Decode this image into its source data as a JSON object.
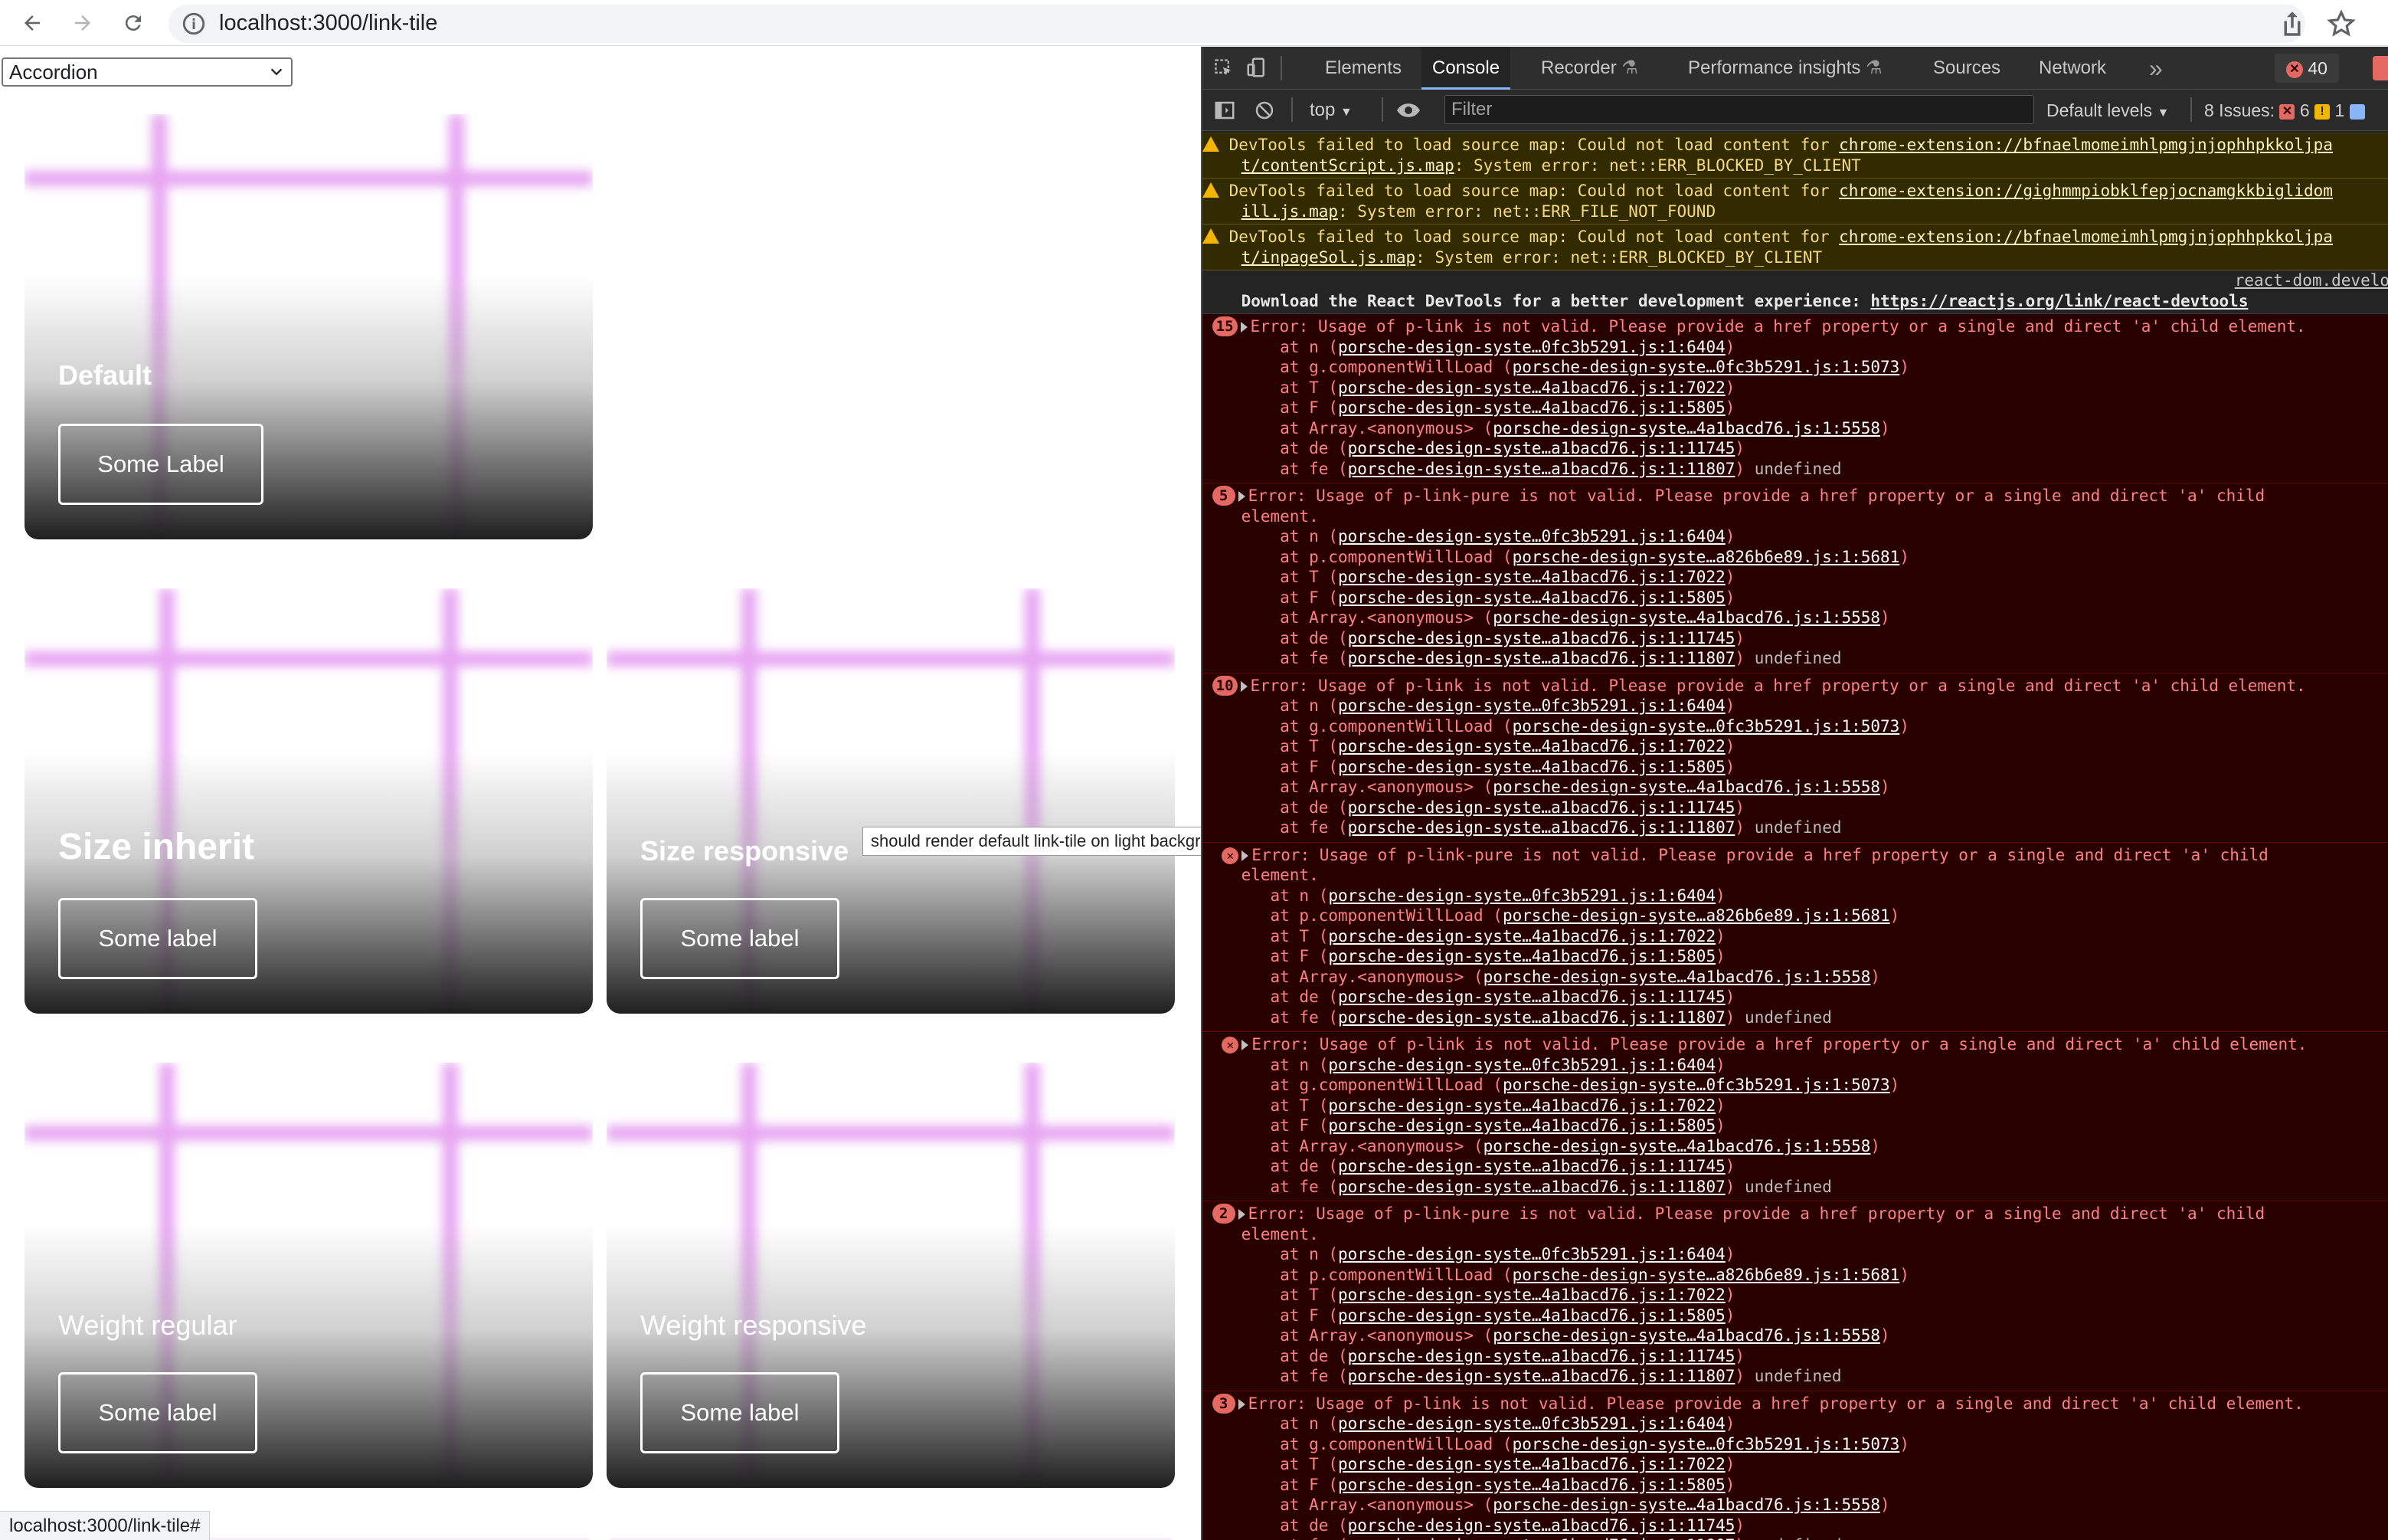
{
  "browser": {
    "url": "localhost:3000/link-tile"
  },
  "page": {
    "select_value": "Accordion",
    "tiles": [
      {
        "title": "Default",
        "button": "Some Label"
      },
      {
        "title": "Size inherit",
        "button": "Some label"
      },
      {
        "title": "Size responsive",
        "button": "Some label"
      },
      {
        "title": "Weight regular",
        "button": "Some label"
      },
      {
        "title": "Weight responsive",
        "button": "Some label"
      }
    ],
    "tooltip": "should render default link-tile on light background",
    "status_url": "localhost:3000/link-tile#"
  },
  "devtools": {
    "tabs": [
      "Elements",
      "Console",
      "Recorder",
      "Performance insights",
      "Sources",
      "Network"
    ],
    "more_tabs": "»",
    "error_count": "40",
    "context": "top",
    "filter_placeholder": "Filter",
    "levels": "Default levels",
    "issues_label": "8 Issues:",
    "issues_errors": "6",
    "issues_warnings": "1",
    "messages": [
      {
        "kind": "warn",
        "parts": [
          [
            "DevTools failed to load source map: Could not load content for ",
            ""
          ],
          [
            "chrome-extension://bfnaelmomeimhlpmgjnjophhpkkoljpa",
            "u"
          ]
        ],
        "cont": [
          [
            "t/contentScript.js.map",
            "u"
          ],
          [
            ": System error: net::ERR_BLOCKED_BY_CLIENT",
            ""
          ]
        ]
      },
      {
        "kind": "warn",
        "parts": [
          [
            "DevTools failed to load source map: Could not load content for ",
            ""
          ],
          [
            "chrome-extension://gighmmpiobklfepjocnamgkkbiglidom",
            "u"
          ]
        ],
        "cont": [
          [
            "ill.js.map",
            "u"
          ],
          [
            ": System error: net::ERR_FILE_NOT_FOUND",
            ""
          ]
        ]
      },
      {
        "kind": "warn",
        "parts": [
          [
            "DevTools failed to load source map: Could not load content for ",
            ""
          ],
          [
            "chrome-extension://bfnaelmomeimhlpmgjnjophhpkkoljpa",
            "u"
          ]
        ],
        "cont": [
          [
            "t/inpageSol.js.map",
            "u"
          ],
          [
            ": System error: net::ERR_BLOCKED_BY_CLIENT",
            ""
          ]
        ]
      }
    ],
    "react_source": "react-dom.develo",
    "react_text": "Download the React DevTools for a better development experience: ",
    "react_link": "https://reactjs.org/link/react-devtools",
    "errors": [
      {
        "badge": "15",
        "text": "Error: Usage of p-link is not valid. Please provide a href property or a single and direct 'a' child element.",
        "wrap": "",
        "cwl": "g.componentWillLoad",
        "cwl_src": "porsche-design-syste…0fc3b5291.js:1:5073"
      },
      {
        "badge": "5",
        "text": "Error: Usage of p-link-pure is not valid. Please provide a href property or a single and direct 'a' child",
        "wrap": "element.",
        "cwl": "p.componentWillLoad",
        "cwl_src": "porsche-design-syste…a826b6e89.js:1:5681"
      },
      {
        "badge": "10",
        "text": "Error: Usage of p-link is not valid. Please provide a href property or a single and direct 'a' child element.",
        "wrap": "",
        "cwl": "g.componentWillLoad",
        "cwl_src": "porsche-design-syste…0fc3b5291.js:1:5073"
      },
      {
        "badge": "",
        "text": "Error: Usage of p-link-pure is not valid. Please provide a href property or a single and direct 'a' child",
        "wrap": "element.",
        "cwl": "p.componentWillLoad",
        "cwl_src": "porsche-design-syste…a826b6e89.js:1:5681"
      },
      {
        "badge": "",
        "text": "Error: Usage of p-link is not valid. Please provide a href property or a single and direct 'a' child element.",
        "wrap": "",
        "cwl": "g.componentWillLoad",
        "cwl_src": "porsche-design-syste…0fc3b5291.js:1:5073"
      },
      {
        "badge": "2",
        "text": "Error: Usage of p-link-pure is not valid. Please provide a href property or a single and direct 'a' child",
        "wrap": "element.",
        "cwl": "p.componentWillLoad",
        "cwl_src": "porsche-design-syste…a826b6e89.js:1:5681"
      },
      {
        "badge": "3",
        "text": "Error: Usage of p-link is not valid. Please provide a href property or a single and direct 'a' child element.",
        "wrap": "",
        "cwl": "g.componentWillLoad",
        "cwl_src": "porsche-design-syste…0fc3b5291.js:1:5073"
      }
    ],
    "stack": {
      "n": "porsche-design-syste…0fc3b5291.js:1:6404",
      "T": "porsche-design-syste…4a1bacd76.js:1:7022",
      "F": "porsche-design-syste…4a1bacd76.js:1:5805",
      "arr": "porsche-design-syste…4a1bacd76.js:1:5558",
      "de": "porsche-design-syste…a1bacd76.js:1:11745",
      "fe": "porsche-design-syste…a1bacd76.js:1:11807",
      "undefined": "undefined"
    }
  }
}
